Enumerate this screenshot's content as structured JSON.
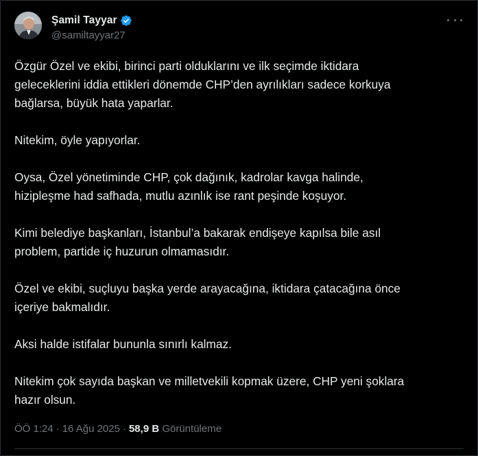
{
  "author": {
    "display_name": "Şamil Tayyar",
    "handle": "@samiltayyar27",
    "verified_color": "#1d9bf0"
  },
  "tweet": {
    "paragraphs": [
      [
        "Özgür Özel ve ekibi, birinci parti olduklarını ve ilk seçimde iktidara",
        "geleceklerini iddia ettikleri dönemde CHP’den ayrılıkları sadece korkuya",
        "bağlarsa, büyük hata yaparlar."
      ],
      [
        "Nitekim, öyle yapıyorlar."
      ],
      [
        "Oysa, Özel yönetiminde CHP, çok dağınık, kadrolar kavga halinde,",
        "hizipleşme had safhada, mutlu azınlık ise rant peşinde koşuyor."
      ],
      [
        "Kimi belediye başkanları, İstanbul’a bakarak endişeye kapılsa bile asıl",
        "problem, partide iç huzurun olmamasıdır."
      ],
      [
        "Özel ve ekibi, suçluyu başka yerde arayacağına, iktidara çatacağına önce",
        "içeriye bakmalıdır."
      ],
      [
        "Aksi halde istifalar bununla sınırlı kalmaz."
      ],
      [
        "Nitekim çok sayıda başkan ve milletvekili kopmak üzere, CHP yeni şoklara",
        "hazır olsun."
      ]
    ]
  },
  "meta": {
    "time": "ÖÖ 1:24",
    "separator": "·",
    "date": "16 Ağu 2025",
    "views_count": "58,9 B",
    "views_label": "Görüntüleme"
  },
  "icons": {
    "more": "more-horizontal-icon",
    "verified": "verified-badge-icon"
  },
  "colors": {
    "background": "#000000",
    "text": "#e7e9ea",
    "muted": "#71767b",
    "accent": "#1d9bf0"
  }
}
